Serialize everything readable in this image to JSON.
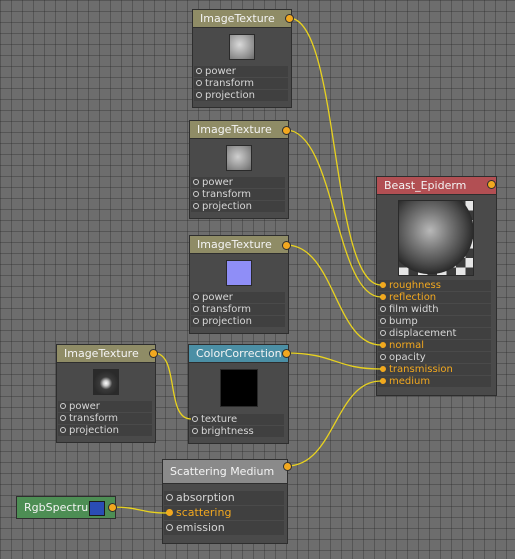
{
  "nodes": {
    "tex1": {
      "title": "ImageTexture",
      "params": [
        "power",
        "transform",
        "projection"
      ]
    },
    "tex2": {
      "title": "ImageTexture",
      "params": [
        "power",
        "transform",
        "projection"
      ]
    },
    "tex3": {
      "title": "ImageTexture",
      "params": [
        "power",
        "transform",
        "projection"
      ]
    },
    "tex4": {
      "title": "ImageTexture",
      "params": [
        "power",
        "transform",
        "projection"
      ]
    },
    "color_correction": {
      "title": "ColorCorrection",
      "params": [
        "texture",
        "brightness"
      ]
    },
    "scattering": {
      "title": "Scattering Medium",
      "params": [
        "absorption",
        "scattering",
        "emission"
      ]
    },
    "rgb": {
      "title": "RgbSpectrum",
      "swatch_color": "#2a4db5"
    },
    "material": {
      "title": "Beast_Epiderm",
      "params": [
        "roughness",
        "reflection",
        "film width",
        "bump",
        "displacement",
        "normal",
        "opacity",
        "transmission",
        "medium"
      ],
      "wired": [
        "roughness",
        "reflection",
        "normal",
        "transmission",
        "medium"
      ]
    }
  },
  "colors": {
    "wire": "#e8d21f",
    "port_active": "#f2a81f",
    "texture_header": "#8f8c66",
    "material_header": "#b24f53",
    "colorcorrection_header": "#4b8fa5",
    "rgb_header": "#4d8e54"
  }
}
